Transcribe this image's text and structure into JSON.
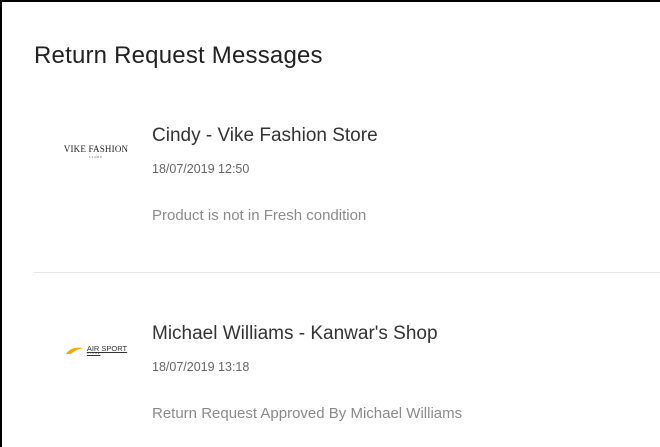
{
  "header": {
    "title": "Return Request Messages"
  },
  "messages": [
    {
      "logo": {
        "icon": "vike-fashion-logo",
        "wordmark": "VIKE FASHION",
        "sub": "STORE"
      },
      "sender": "Cindy - Vike Fashion Store",
      "datetime": "18/07/2019 12:50",
      "text": "Product is not in Fresh condition"
    },
    {
      "logo": {
        "icon": "air-sport-logo",
        "wordmark": "AIR SPORT",
        "sub": "STORE",
        "accent": "#f2a900"
      },
      "sender": "Michael Williams - Kanwar's Shop",
      "datetime": "18/07/2019 13:18",
      "text": "Return Request Approved By Michael Williams"
    }
  ]
}
